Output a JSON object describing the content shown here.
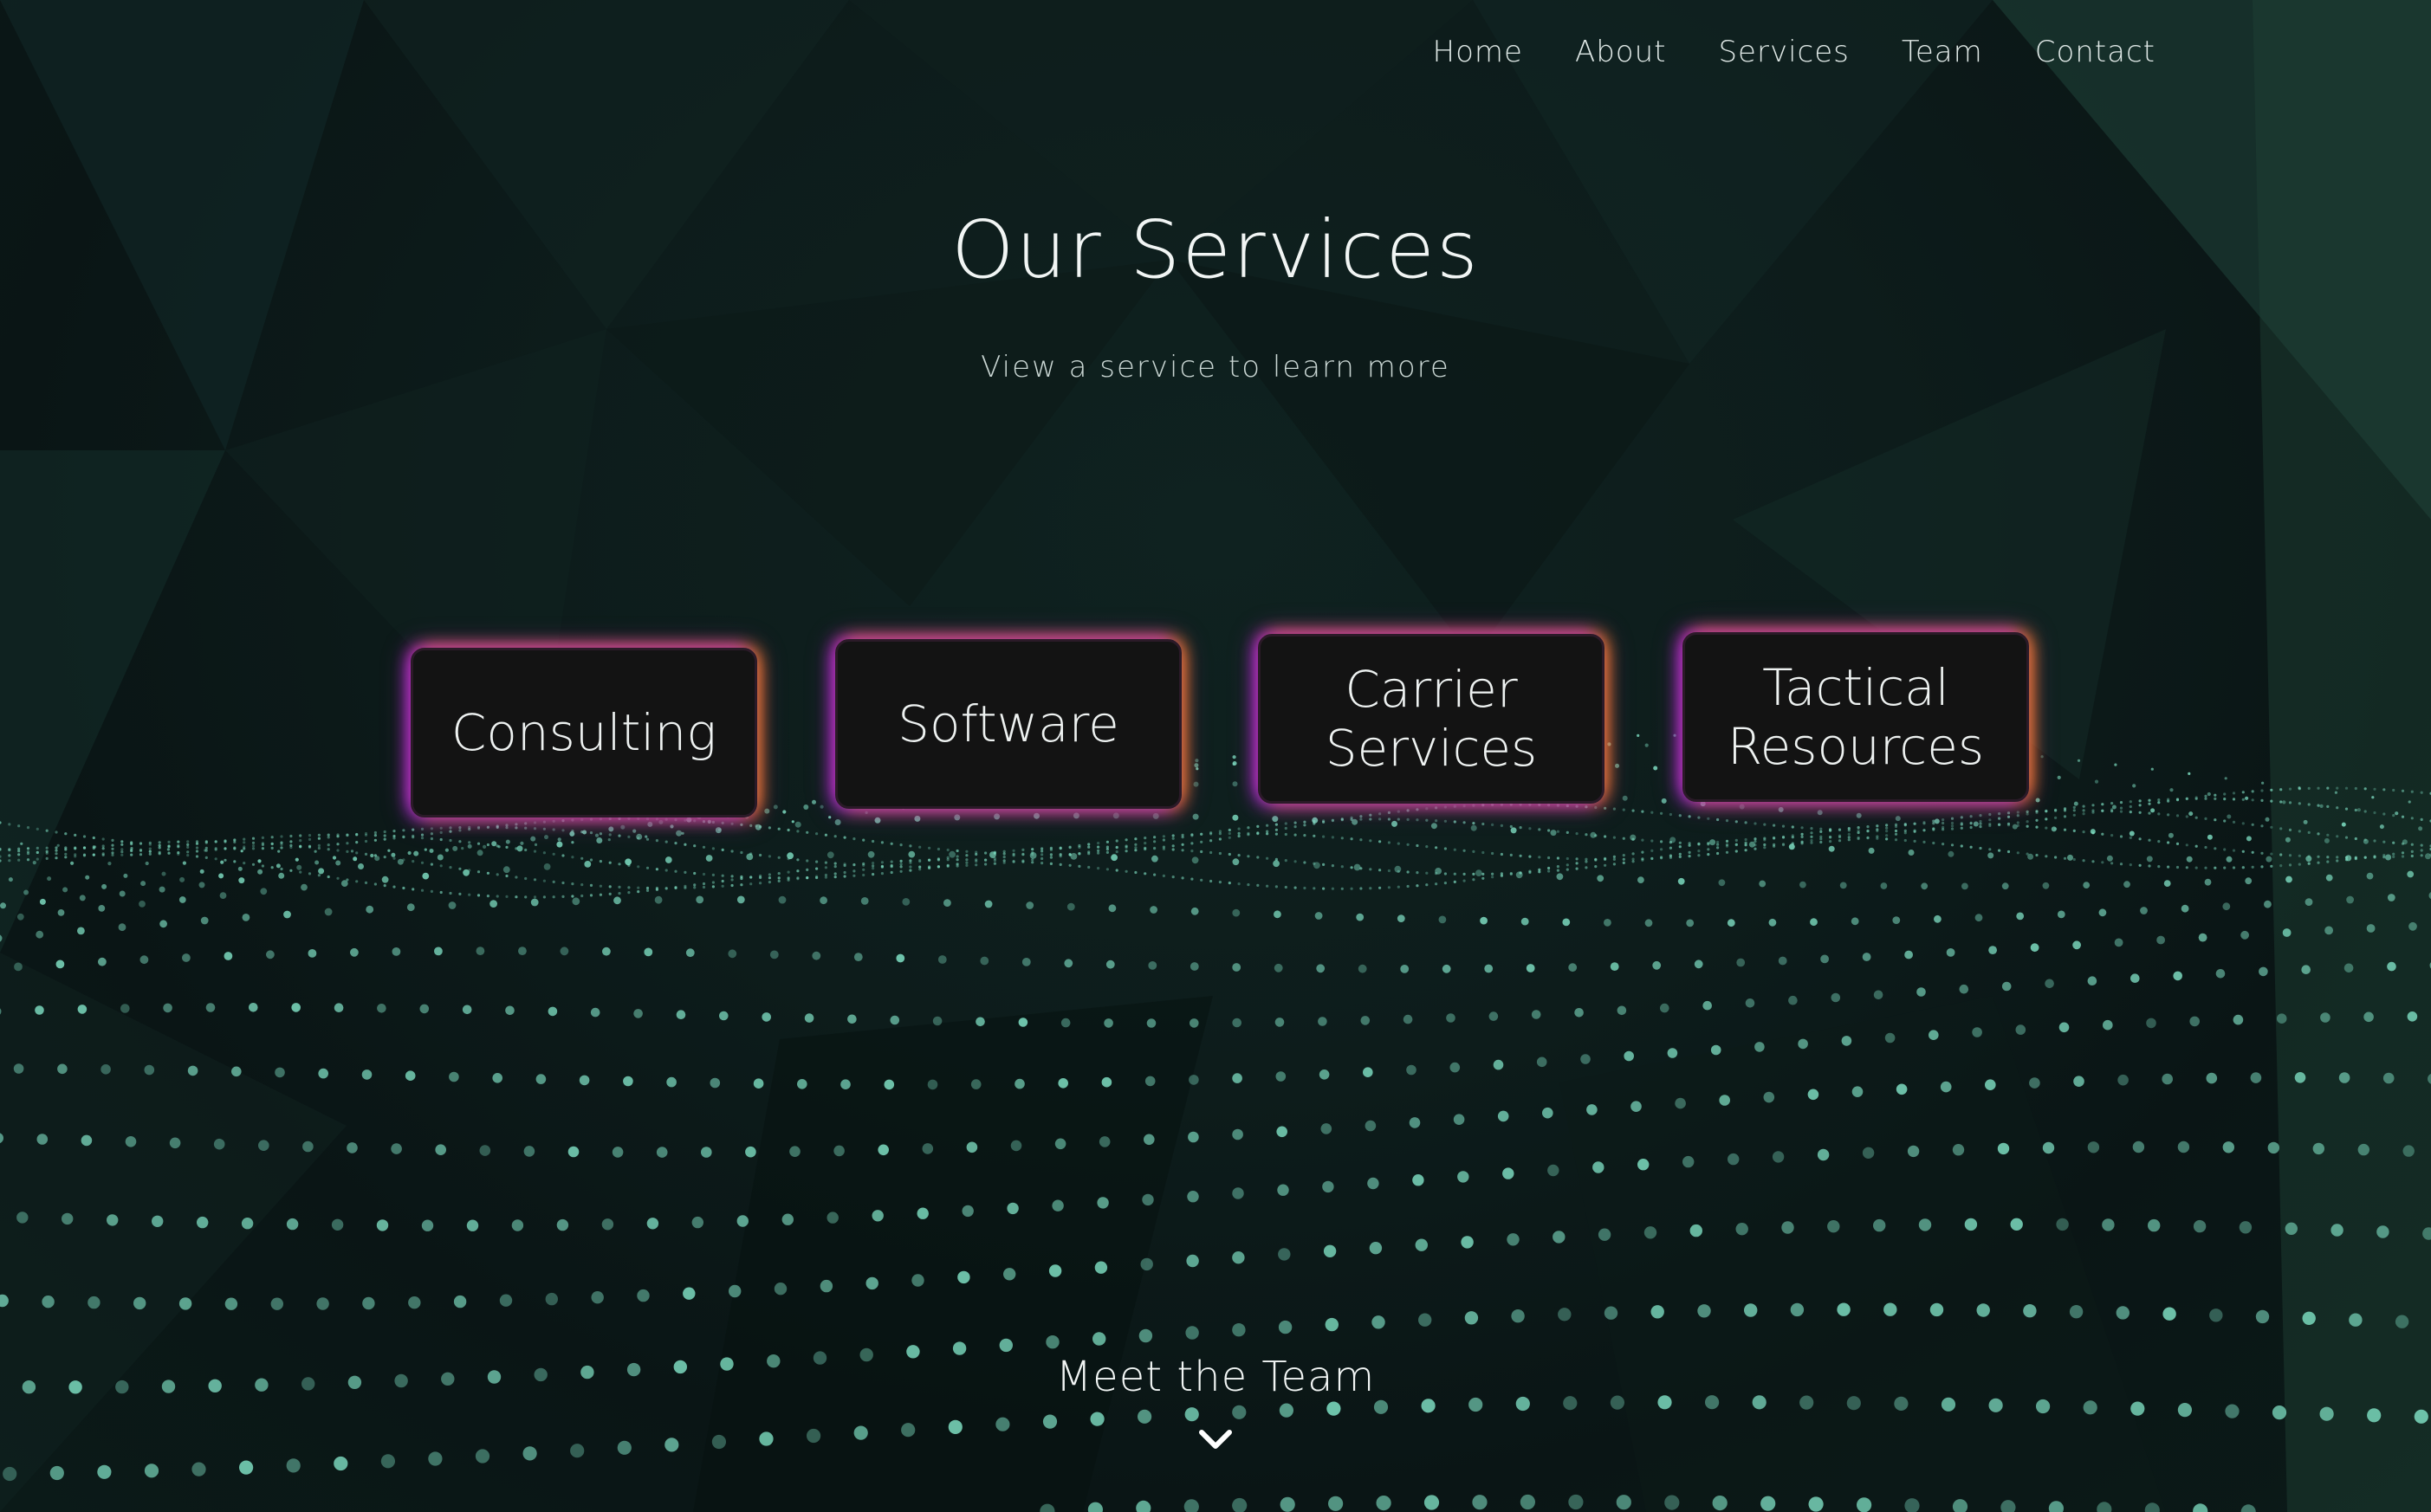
{
  "nav": {
    "items": [
      {
        "label": "Home"
      },
      {
        "label": "About"
      },
      {
        "label": "Services"
      },
      {
        "label": "Team"
      },
      {
        "label": "Contact"
      }
    ]
  },
  "main": {
    "title": "Our Services",
    "subtitle": "View a service to learn more",
    "cards": [
      {
        "label": "Consulting"
      },
      {
        "label": "Software"
      },
      {
        "label": "Carrier Services"
      },
      {
        "label": "Tactical Resources"
      }
    ]
  },
  "footer": {
    "next_section_label": "Meet the Team",
    "next_icon": "chevron-down-icon"
  },
  "colors": {
    "background": "#0d1c1b",
    "dot": "#7fe0c4",
    "glow_purple": "#b42ad0",
    "glow_orange": "#f08c14"
  }
}
